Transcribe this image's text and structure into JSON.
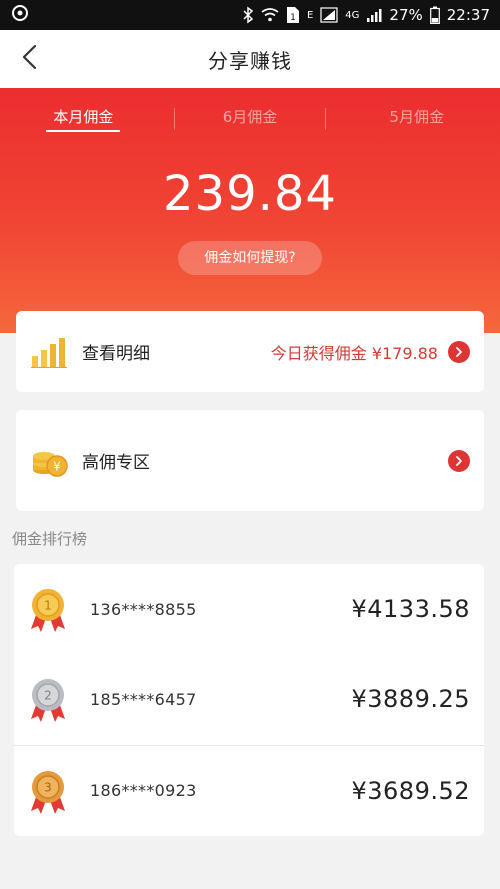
{
  "status_bar": {
    "network_letter": "E",
    "network_type": "4G",
    "battery": "27%",
    "time": "22:37"
  },
  "nav": {
    "title": "分享赚钱"
  },
  "tabs": [
    {
      "label": "本月佣金",
      "active": true
    },
    {
      "label": "6月佣金",
      "active": false
    },
    {
      "label": "5月佣金",
      "active": false
    }
  ],
  "summary": {
    "amount": "239.84",
    "withdraw_label": "佣金如何提现?"
  },
  "details_card": {
    "label": "查看明细",
    "today_label": "今日获得佣金 ¥179.88"
  },
  "high_zone_card": {
    "label": "高佣专区"
  },
  "leaderboard": {
    "title": "佣金排行榜",
    "rows": [
      {
        "rank": 1,
        "phone": "136****8855",
        "amount": "¥4133.58"
      },
      {
        "rank": 2,
        "phone": "185****6457",
        "amount": "¥3889.25"
      },
      {
        "rank": 3,
        "phone": "186****0923",
        "amount": "¥3689.52"
      }
    ]
  },
  "colors": {
    "hero_top": "#ec2d2f",
    "hero_bottom": "#f5673c",
    "accent_red": "#dd3434",
    "gold": "#f2b233",
    "silver": "#b9bcc2",
    "bronze": "#e59a3d"
  },
  "icons": {
    "back": "chevron-left-icon",
    "details": "bar-chart-icon",
    "high_zone": "coins-icon",
    "arrow": "chevron-right-icon",
    "medal": "medal-icon"
  }
}
